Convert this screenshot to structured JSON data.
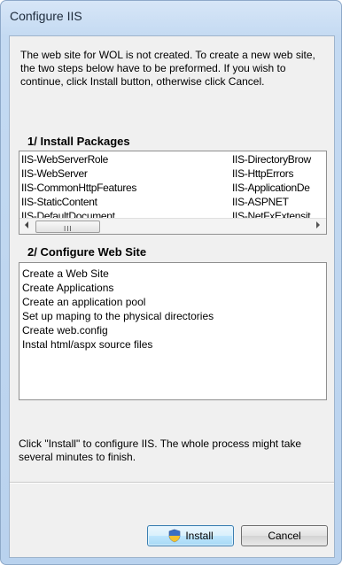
{
  "window": {
    "title": "Configure IIS"
  },
  "intro_text": "The web site for WOL is not created. To create a new web site, the two steps below have to be preformed. If you wish to continue, click Install button, otherwise click Cancel.",
  "install_packages": {
    "heading": "1/ Install Packages",
    "column1": [
      "IIS-WebServerRole",
      "IIS-WebServer",
      "IIS-CommonHttpFeatures",
      "IIS-StaticContent",
      "IIS-DefaultDocument"
    ],
    "column2": [
      "IIS-DirectoryBrow",
      "IIS-HttpErrors",
      "IIS-ApplicationDe",
      "IIS-ASPNET",
      "IIS-NetFxExtensit"
    ],
    "scrollbar_grip": "III"
  },
  "configure_site": {
    "heading": "2/ Configure Web Site",
    "steps": [
      "Create a Web Site",
      "Create Applications",
      "Create an application pool",
      "Set up maping to the physical directories",
      "Create web.config",
      "Instal html/aspx source files"
    ]
  },
  "footer_note": "Click \"Install\" to configure IIS. The whole process might take several minutes to finish.",
  "buttons": {
    "install_label": "Install",
    "install_icon": "uac-shield-icon",
    "cancel_label": "Cancel"
  }
}
